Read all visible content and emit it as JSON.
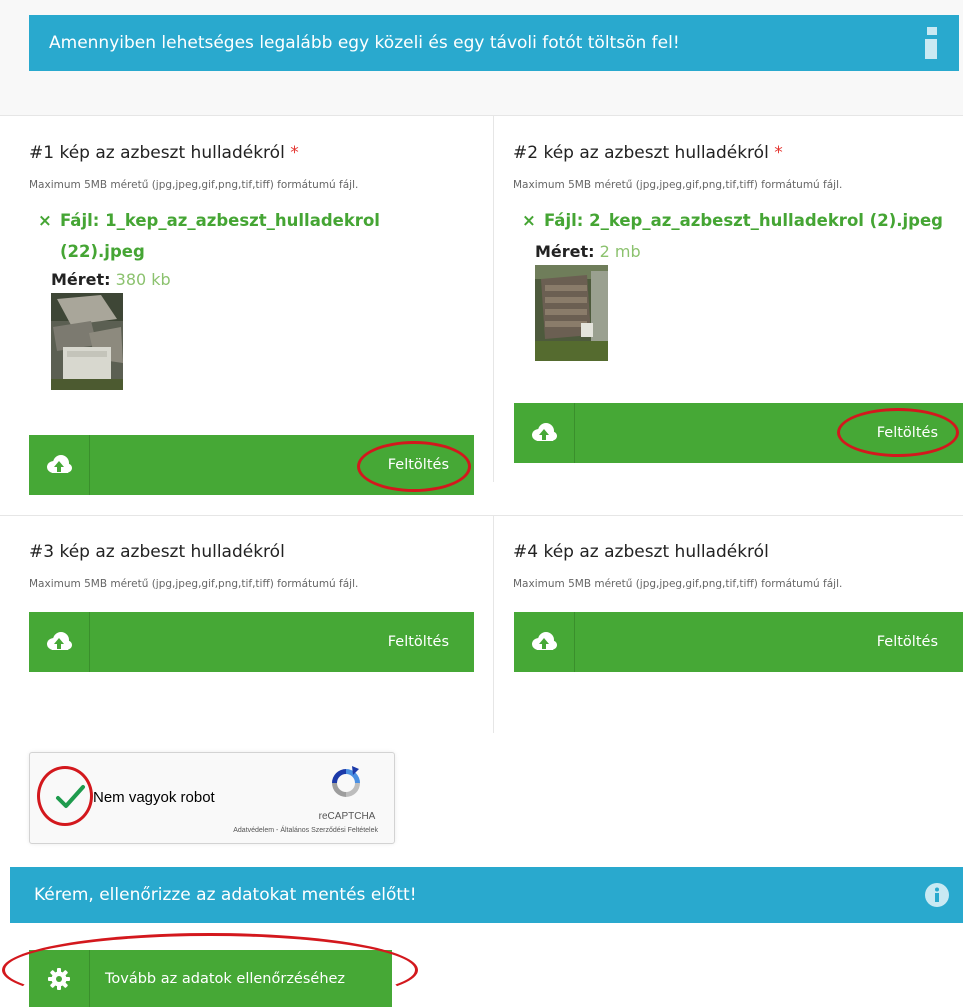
{
  "notice": {
    "text": "Amennyiben lehetséges legalább egy közeli és egy távoli fotót töltsön fel!",
    "icon": "info-icon"
  },
  "slots": [
    {
      "title": "#1 kép az azbeszt hulladékról",
      "required": "*",
      "hint": "Maximum 5MB méretű (jpg,jpeg,gif,png,tif,tiff) formátumú fájl.",
      "file_line1": "Fájl: 1_kep_az_azbeszt_hulladekrol",
      "file_line2": "(22).jpeg",
      "size_label": "Méret:",
      "size_value": "380 kb",
      "upload_label": "Feltöltés"
    },
    {
      "title": "#2 kép az azbeszt hulladékról",
      "required": "*",
      "hint": "Maximum 5MB méretű (jpg,jpeg,gif,png,tif,tiff) formátumú fájl.",
      "file_line1": "Fájl: 2_kep_az_azbeszt_hulladekrol (2).jpeg",
      "size_label": "Méret:",
      "size_value": "2 mb",
      "upload_label": "Feltöltés"
    },
    {
      "title": "#3 kép az azbeszt hulladékról",
      "hint": "Maximum 5MB méretű (jpg,jpeg,gif,png,tif,tiff) formátumú fájl.",
      "upload_label": "Feltöltés"
    },
    {
      "title": "#4 kép az azbeszt hulladékról",
      "hint": "Maximum 5MB méretű (jpg,jpeg,gif,png,tif,tiff) formátumú fájl.",
      "upload_label": "Feltöltés"
    }
  ],
  "remove_symbol": "×",
  "recaptcha": {
    "label": "Nem vagyok robot",
    "brand": "reCAPTCHA",
    "terms": "Adatvédelem - Általános Szerződési Feltételek"
  },
  "check_notice": {
    "text": "Kérem, ellenőrizze az adatokat mentés előtt!"
  },
  "next_button": {
    "label": "Tovább az adatok ellenőrzéséhez"
  },
  "colors": {
    "info_blue": "#29a9ce",
    "action_green": "#46a836",
    "highlight_red": "#d3181d",
    "file_green": "#45a534"
  }
}
